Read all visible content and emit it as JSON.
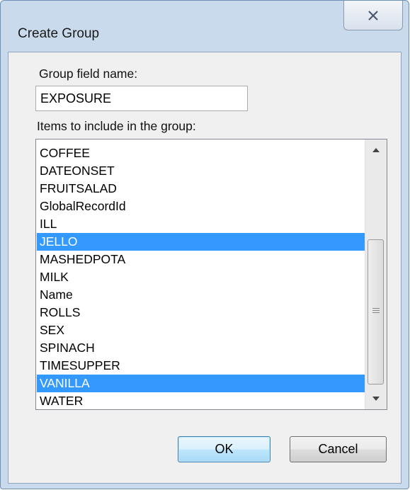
{
  "dialog": {
    "title": "Create Group",
    "close_icon": "close-icon"
  },
  "group_field": {
    "label": "Group field name:",
    "value": "EXPOSURE"
  },
  "items": {
    "label": "Items to include in the group:",
    "list": [
      {
        "label": "COFFEE",
        "selected": false
      },
      {
        "label": "DATEONSET",
        "selected": false
      },
      {
        "label": "FRUITSALAD",
        "selected": false
      },
      {
        "label": "GlobalRecordId",
        "selected": false
      },
      {
        "label": "ILL",
        "selected": false
      },
      {
        "label": "JELLO",
        "selected": true
      },
      {
        "label": "MASHEDPOTA",
        "selected": false
      },
      {
        "label": "MILK",
        "selected": false
      },
      {
        "label": "Name",
        "selected": false
      },
      {
        "label": "ROLLS",
        "selected": false
      },
      {
        "label": "SEX",
        "selected": false
      },
      {
        "label": "SPINACH",
        "selected": false
      },
      {
        "label": "TIMESUPPER",
        "selected": false
      },
      {
        "label": "VANILLA",
        "selected": true
      },
      {
        "label": "WATER",
        "selected": false
      }
    ],
    "selection_color": "#3399ff"
  },
  "buttons": {
    "ok": "OK",
    "cancel": "Cancel"
  }
}
